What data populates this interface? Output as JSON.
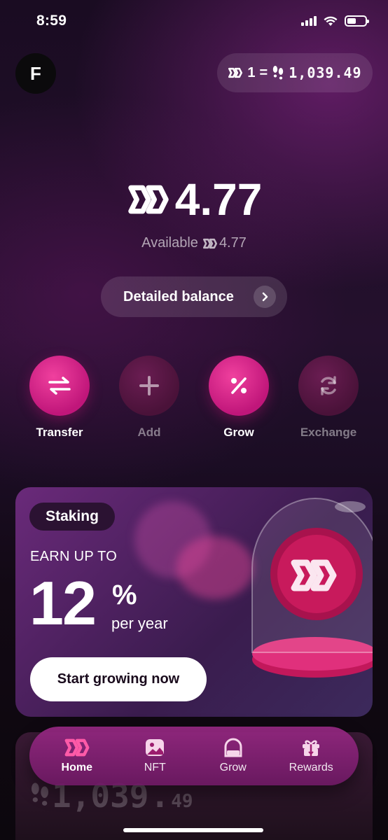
{
  "status_bar": {
    "time": "8:59"
  },
  "header": {
    "avatar_letter": "F",
    "rate": {
      "left": "1",
      "equals": "=",
      "right": "1,039.49"
    }
  },
  "balance": {
    "amount": "4.77",
    "available_label": "Available",
    "available_amount": "4.77"
  },
  "detailed_balance_label": "Detailed balance",
  "actions": [
    {
      "label": "Transfer",
      "icon": "transfer-icon",
      "enabled": true
    },
    {
      "label": "Add",
      "icon": "plus-icon",
      "enabled": false
    },
    {
      "label": "Grow",
      "icon": "percent-icon",
      "enabled": true
    },
    {
      "label": "Exchange",
      "icon": "exchange-icon",
      "enabled": false
    }
  ],
  "staking": {
    "tag": "Staking",
    "earn_text": "EARN UP TO",
    "rate_number": "12",
    "rate_unit": "%",
    "period": "per year",
    "cta": "Start growing now"
  },
  "ghost_card": {
    "amount_main": "1,039",
    "amount_dot": ".",
    "amount_dec": "49"
  },
  "tabs": [
    {
      "label": "Home",
      "icon": "home-logo-icon",
      "active": true
    },
    {
      "label": "NFT",
      "icon": "nft-image-icon",
      "active": false
    },
    {
      "label": "Grow",
      "icon": "grow-dome-icon",
      "active": false
    },
    {
      "label": "Rewards",
      "icon": "gift-icon",
      "active": false
    }
  ],
  "colors": {
    "accent": "#d41e86",
    "accent_dim": "#4f1540",
    "background": "#1a0c22"
  }
}
